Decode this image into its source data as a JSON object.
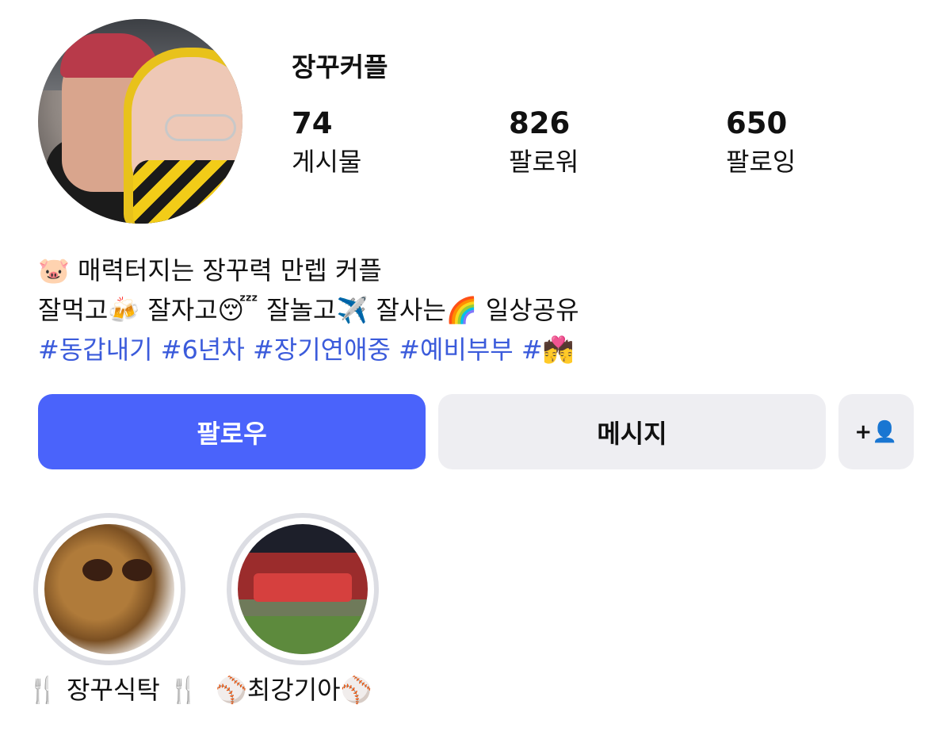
{
  "profile": {
    "username": "장꾸커플",
    "stats": [
      {
        "value": "74",
        "label": "게시물"
      },
      {
        "value": "826",
        "label": "팔로워"
      },
      {
        "value": "650",
        "label": "팔로잉"
      }
    ]
  },
  "bio": {
    "line1": "🐷 매력터지는 장꾸력 만렙 커플",
    "line2": "잘먹고🍻 잘자고😴 잘놀고✈️ 잘사는🌈 일상공유",
    "hashtags": "#동갑내기 #6년차 #장기연애중 #예비부부 #💏"
  },
  "actions": {
    "follow": "팔로우",
    "message": "메시지",
    "add_user": "+👤"
  },
  "highlights": [
    {
      "label": "🍴 장꾸식탁 🍴"
    },
    {
      "label": "⚾️최강기아⚾️"
    }
  ],
  "colors": {
    "accent": "#4a63fb",
    "hashtag": "#3b5bdb",
    "button_gray": "#eeeef2"
  }
}
